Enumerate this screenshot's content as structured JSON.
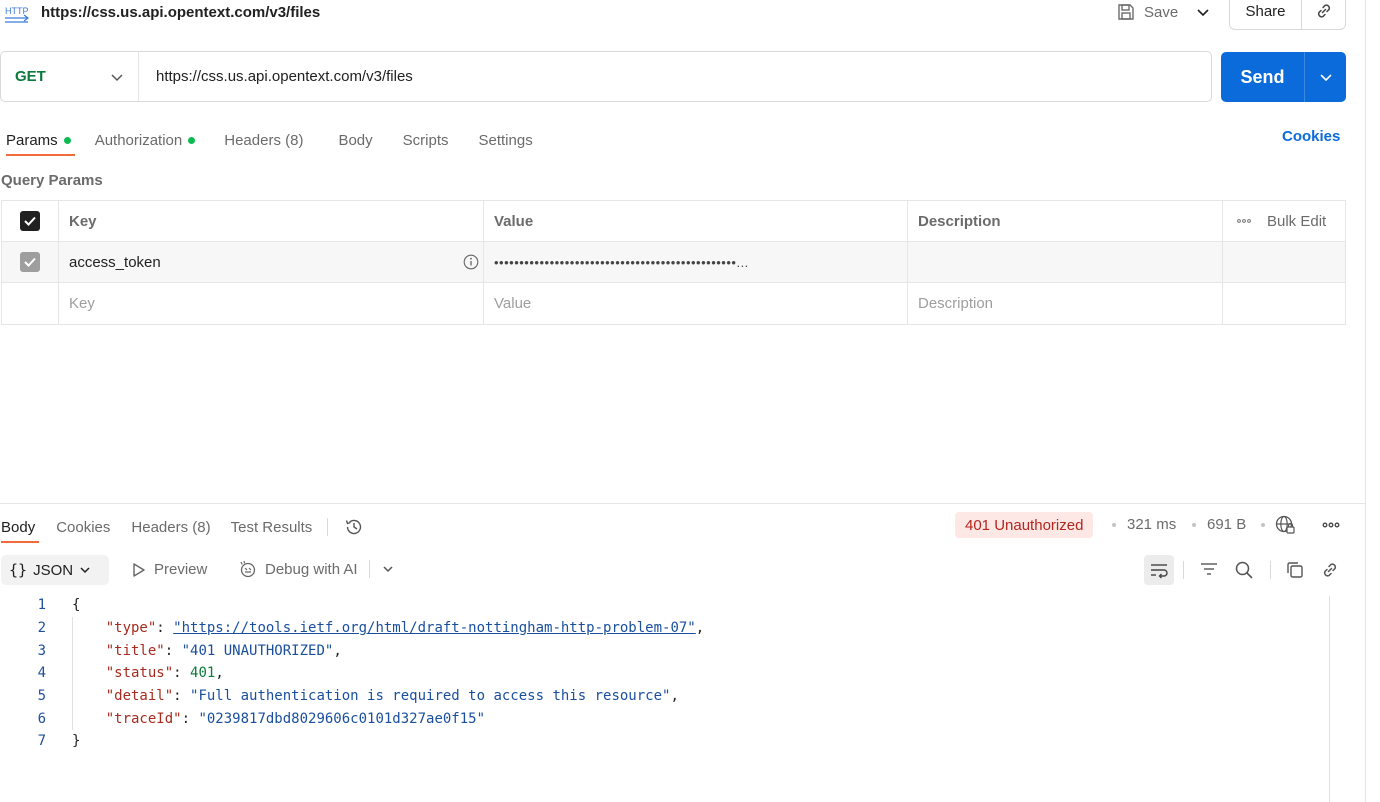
{
  "header": {
    "icon_text": "HTTP",
    "title": "https://css.us.api.opentext.com/v3/files",
    "save_label": "Save",
    "share_label": "Share"
  },
  "request": {
    "method": "GET",
    "url": "https://css.us.api.opentext.com/v3/files",
    "send_label": "Send"
  },
  "request_tabs": {
    "params": "Params",
    "authorization": "Authorization",
    "headers": "Headers (8)",
    "body": "Body",
    "scripts": "Scripts",
    "settings": "Settings",
    "cookies": "Cookies"
  },
  "query_params": {
    "title": "Query Params",
    "columns": {
      "key": "Key",
      "value": "Value",
      "description": "Description",
      "bulk_edit": "Bulk Edit"
    },
    "rows": [
      {
        "checked": true,
        "key": "access_token",
        "value": "••••••••••••••••••••••••••••••••••••••••••••••••..."
      }
    ],
    "placeholders": {
      "key": "Key",
      "value": "Value",
      "description": "Description"
    }
  },
  "response_tabs": {
    "body": "Body",
    "cookies": "Cookies",
    "headers": "Headers (8)",
    "test_results": "Test Results"
  },
  "response_meta": {
    "status": "401 Unauthorized",
    "time": "321 ms",
    "size": "691 B"
  },
  "response_toolbar": {
    "format": "JSON",
    "preview": "Preview",
    "debug": "Debug with AI"
  },
  "response_body": {
    "line_numbers": [
      "1",
      "2",
      "3",
      "4",
      "5",
      "6",
      "7"
    ],
    "open_brace": "{",
    "close_brace": "}",
    "fields": [
      {
        "key": "\"type\"",
        "value": "\"https://tools.ietf.org/html/draft-nottingham-http-problem-07\"",
        "kind": "url"
      },
      {
        "key": "\"title\"",
        "value": "\"401 UNAUTHORIZED\"",
        "kind": "str"
      },
      {
        "key": "\"status\"",
        "value": "401",
        "kind": "num"
      },
      {
        "key": "\"detail\"",
        "value": "\"Full authentication is required to access this resource\"",
        "kind": "str"
      },
      {
        "key": "\"traceId\"",
        "value": "\"0239817dbd8029606c0101d327ae0f15\"",
        "kind": "str"
      }
    ]
  },
  "colors": {
    "accent": "#0b6bda",
    "method_get": "#0b7a3b",
    "tab_underline": "#f26b3a",
    "status_error_bg": "#fde8e6",
    "status_error_text": "#b3261e",
    "dot_green": "#0cbb52"
  }
}
